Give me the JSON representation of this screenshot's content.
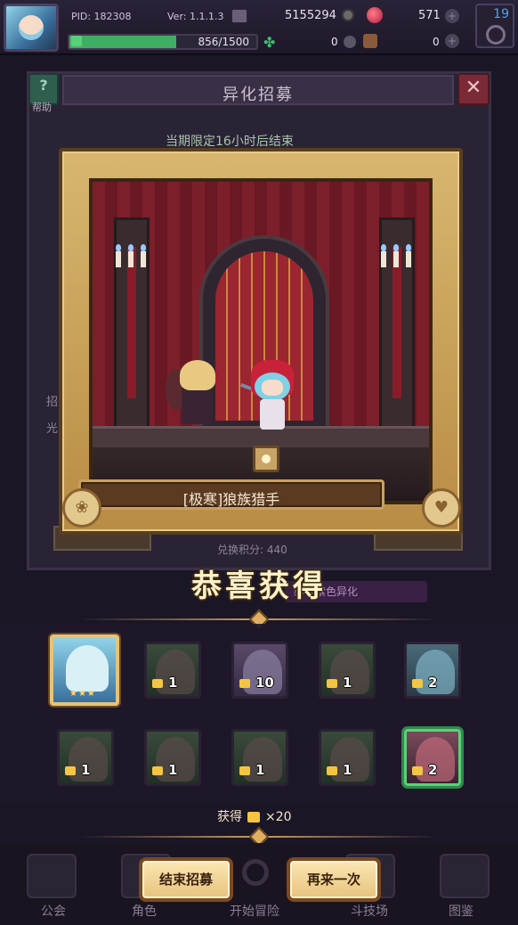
{
  "topbar": {
    "pid": "PID: 182308",
    "version": "Ver: 1.1.1.3",
    "coins": "5155294",
    "gems": "571",
    "energy": "856/1500",
    "energy_fraction": 0.57,
    "stat_a": "0",
    "stat_b": "0",
    "level": "19"
  },
  "background": {
    "title": "异化招募",
    "help_label": "帮助",
    "limited_notice": "当期限定16小时后结束",
    "exchange_points": "兑换积分: 440",
    "side_label_1": "招",
    "side_label_2": "光",
    "promo": "必得紫色异化"
  },
  "showcase": {
    "character_name": "[极寒]狼族猎手"
  },
  "result": {
    "congrats": "恭喜获得",
    "featured_stars": "★★★",
    "rewards": [
      {
        "qty": "1",
        "style": "dark"
      },
      {
        "qty": "10",
        "style": "purple"
      },
      {
        "qty": "1",
        "style": "dark"
      },
      {
        "qty": "2",
        "style": "blue"
      },
      {
        "qty": "1",
        "style": "dark"
      },
      {
        "qty": "1",
        "style": "dark"
      },
      {
        "qty": "1",
        "style": "dark"
      },
      {
        "qty": "1",
        "style": "dark"
      },
      {
        "qty": "2",
        "style": "red"
      }
    ],
    "obtained_label": "获得",
    "obtained_count": "×20"
  },
  "buttons": {
    "end": "结束招募",
    "again": "再来一次"
  },
  "nav": {
    "guild": "公会",
    "character": "角色",
    "adventure": "开始冒险",
    "arena": "斗技场",
    "codex": "图鉴"
  },
  "colors": {
    "frame_gold": "#d8b66f",
    "button_cream": "#fbe7b4",
    "selected_green": "#5bd07a",
    "energy_green": "#3fae62",
    "level_blue": "#3fa7ff"
  }
}
